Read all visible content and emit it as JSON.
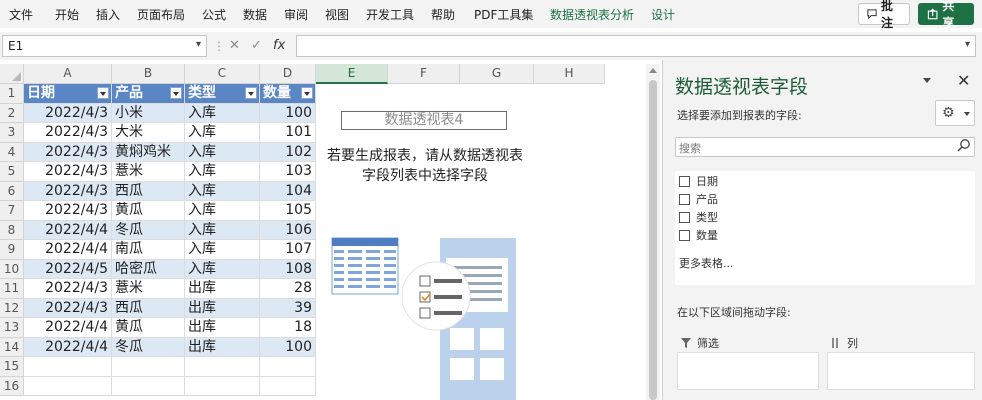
{
  "ribbon": {
    "tabs": [
      "文件",
      "开始",
      "插入",
      "页面布局",
      "公式",
      "数据",
      "审阅",
      "视图",
      "开发工具",
      "帮助",
      "PDF工具集",
      "数据透视表分析",
      "设计"
    ],
    "comment_label": "批注",
    "share_label": "共享"
  },
  "formula_bar": {
    "name_box": "E1",
    "fx_label": "fx",
    "formula_value": ""
  },
  "grid": {
    "columns": [
      "A",
      "B",
      "C",
      "D",
      "E",
      "F",
      "G",
      "H"
    ],
    "selected_column": "E",
    "rows": [
      "1",
      "2",
      "3",
      "4",
      "5",
      "6",
      "7",
      "8",
      "9",
      "10",
      "11",
      "12",
      "13",
      "14",
      "15",
      "16"
    ],
    "table_headers": [
      "日期",
      "产品",
      "类型",
      "数量"
    ],
    "table_rows": [
      [
        "2022/4/3",
        "小米",
        "入库",
        "100"
      ],
      [
        "2022/4/3",
        "大米",
        "入库",
        "101"
      ],
      [
        "2022/4/3",
        "黄焖鸡米",
        "入库",
        "102"
      ],
      [
        "2022/4/3",
        "薏米",
        "入库",
        "103"
      ],
      [
        "2022/4/3",
        "西瓜",
        "入库",
        "104"
      ],
      [
        "2022/4/3",
        "黄瓜",
        "入库",
        "105"
      ],
      [
        "2022/4/4",
        "冬瓜",
        "入库",
        "106"
      ],
      [
        "2022/4/4",
        "南瓜",
        "入库",
        "107"
      ],
      [
        "2022/4/5",
        "哈密瓜",
        "入库",
        "108"
      ],
      [
        "2022/4/3",
        "薏米",
        "出库",
        "28"
      ],
      [
        "2022/4/3",
        "西瓜",
        "出库",
        "39"
      ],
      [
        "2022/4/4",
        "黄瓜",
        "出库",
        "18"
      ],
      [
        "2022/4/4",
        "冬瓜",
        "出库",
        "100"
      ]
    ]
  },
  "pivot_placeholder": {
    "title": "数据透视表4",
    "hint_line1": "若要生成报表，请从数据透视表",
    "hint_line2": "字段列表中选择字段"
  },
  "field_pane": {
    "title": "数据透视表字段",
    "subtitle": "选择要添加到报表的字段:",
    "search_placeholder": "搜索",
    "fields": [
      "日期",
      "产品",
      "类型",
      "数量"
    ],
    "more_tables": "更多表格...",
    "drag_label": "在以下区域间拖动字段:",
    "filter_area": "筛选",
    "columns_area": "列"
  },
  "colors": {
    "accent_green": "#1e7145",
    "table_header_blue": "#5b86c6",
    "band_blue": "#dde8f5",
    "illustration_blue": "#7fa6d8"
  },
  "icons": [
    "comment-icon",
    "share-icon",
    "gear-icon",
    "search-icon",
    "close-icon",
    "filter-icon",
    "columns-icon",
    "chevron-down-icon"
  ]
}
